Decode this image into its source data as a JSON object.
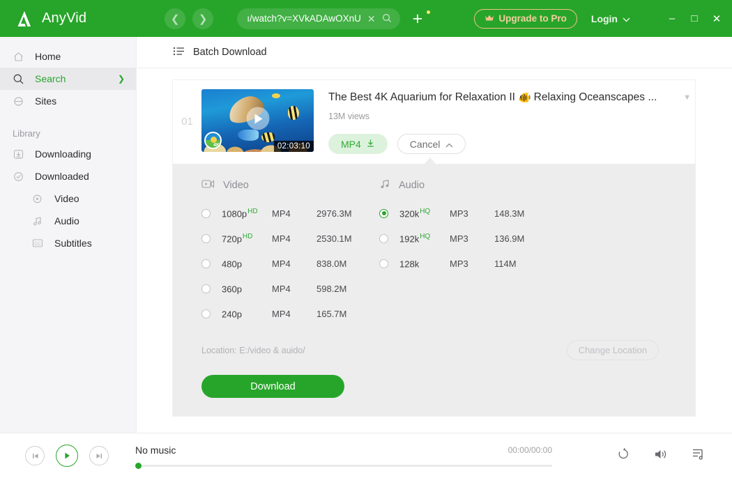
{
  "titlebar": {
    "brand": "AnyVid",
    "back_icon": "chevron-left-icon",
    "forward_icon": "chevron-right-icon",
    "url_value": "ı/watch?v=XVkADAwOXnU",
    "url_clear_icon": "close-icon",
    "url_search_icon": "search-icon",
    "new_tab_icon": "plus-icon",
    "upgrade_label": "Upgrade to Pro",
    "upgrade_icon": "crown-icon",
    "upgrade_color": "#f4cf9e",
    "login_label": "Login",
    "login_caret": "chevron-down-icon",
    "minimize": "–",
    "maximize": "□",
    "close": "✕",
    "bg_color": "#27a52a"
  },
  "sidebar": {
    "items": [
      {
        "label": "Home",
        "icon": "home-icon",
        "active": false
      },
      {
        "label": "Search",
        "icon": "search-icon",
        "active": true
      },
      {
        "label": "Sites",
        "icon": "globe-icon",
        "active": false
      }
    ],
    "section_label": "Library",
    "library": [
      {
        "label": "Downloading",
        "icon": "download-box-icon"
      },
      {
        "label": "Downloaded",
        "icon": "check-circle-icon"
      }
    ],
    "sub_items": [
      {
        "label": "Video",
        "icon": "play-circle-icon"
      },
      {
        "label": "Audio",
        "icon": "music-note-icon"
      },
      {
        "label": "Subtitles",
        "icon": "cc-icon"
      }
    ]
  },
  "main": {
    "batch_label": "Batch Download",
    "batch_icon": "list-icon"
  },
  "card": {
    "index": "01",
    "thumbnail": {
      "duration": "02:03:10",
      "badge": "4K",
      "play_icon": "play-icon"
    },
    "title_before": "The Best 4K Aquarium for Relaxation II",
    "title_emoji": "🐠",
    "title_after": "Relaxing Oceanscapes ...",
    "dropdown_icon": "chevron-down-icon",
    "views": "13M views",
    "format_pill": "MP4",
    "format_pill_icon": "download-icon",
    "cancel_label": "Cancel",
    "cancel_icon": "chevron-up-icon"
  },
  "panel": {
    "video_header": "Video",
    "video_icon": "video-icon",
    "audio_header": "Audio",
    "audio_icon": "music-note-icon",
    "video_options": [
      {
        "quality": "1080p",
        "tag": "HD",
        "format": "MP4",
        "size": "2976.3M",
        "selected": false
      },
      {
        "quality": "720p",
        "tag": "HD",
        "format": "MP4",
        "size": "2530.1M",
        "selected": false
      },
      {
        "quality": "480p",
        "tag": "",
        "format": "MP4",
        "size": "838.0M",
        "selected": false
      },
      {
        "quality": "360p",
        "tag": "",
        "format": "MP4",
        "size": "598.2M",
        "selected": false
      },
      {
        "quality": "240p",
        "tag": "",
        "format": "MP4",
        "size": "165.7M",
        "selected": false
      }
    ],
    "audio_options": [
      {
        "quality": "320k",
        "tag": "HQ",
        "format": "MP3",
        "size": "148.3M",
        "selected": true
      },
      {
        "quality": "192k",
        "tag": "HQ",
        "format": "MP3",
        "size": "136.9M",
        "selected": false
      },
      {
        "quality": "128k",
        "tag": "",
        "format": "MP3",
        "size": "114M",
        "selected": false
      }
    ],
    "location_label": "Location: E:/video & auido/",
    "change_location_label": "Change Location",
    "download_label": "Download",
    "download_color": "#27a52a"
  },
  "player": {
    "prev_icon": "skip-previous-icon",
    "play_icon": "play-icon",
    "next_icon": "skip-next-icon",
    "track_title": "No music",
    "time": "00:00/00:00",
    "repeat_icon": "repeat-icon",
    "volume_icon": "volume-icon",
    "playlist_icon": "playlist-icon",
    "progress_percent": 0
  }
}
